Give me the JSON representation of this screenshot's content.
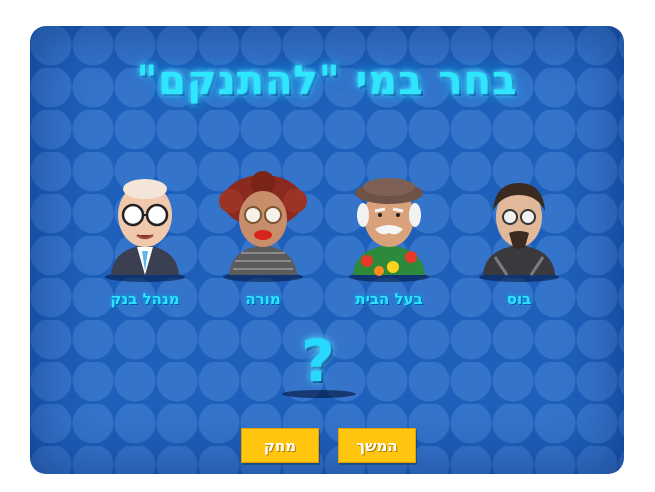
{
  "title": "בחר במי \"להתנקם\"",
  "characters": [
    {
      "id": "bank-manager",
      "label": "מנהל בנק"
    },
    {
      "id": "teacher",
      "label": "מורה"
    },
    {
      "id": "landlord",
      "label": "בעל הבית"
    },
    {
      "id": "boss",
      "label": "בוס"
    }
  ],
  "question_mark": "?",
  "buttons": {
    "delete_label": "מחק",
    "continue_label": "המשך"
  },
  "colors": {
    "background": "#1d5fba",
    "title_glow": "#2fe6ff",
    "button": "#ffc50f"
  }
}
